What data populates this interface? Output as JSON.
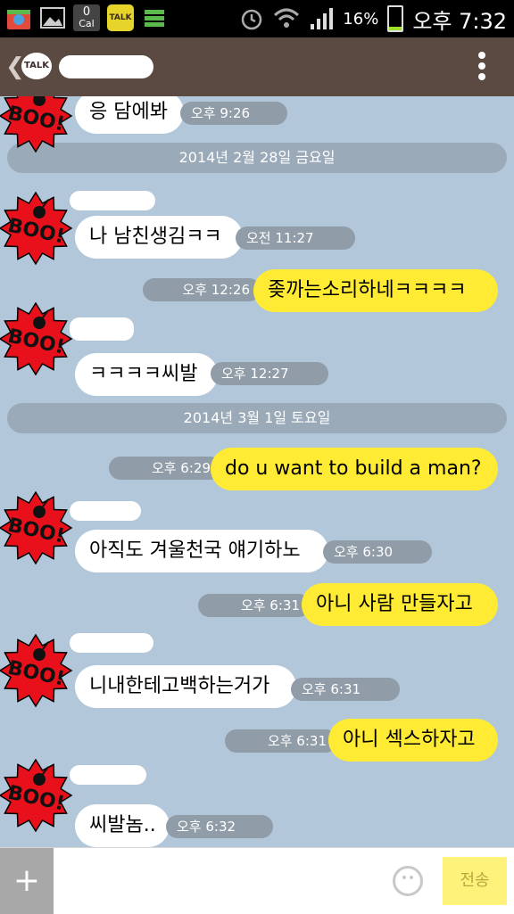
{
  "status_bar": {
    "calendar_count": "0",
    "calendar_label": "Cal",
    "kakaotalk_label": "TALK",
    "battery": "16%",
    "clock": "오후 7:32"
  },
  "header": {
    "back_glyph": "❮",
    "badge": "TALK",
    "title": "",
    "menu_icon": "overflow-menu-icon"
  },
  "chat": {
    "date_separators": [
      "2014년 2월 28일 금요일",
      "2014년 3월 1일 토요일"
    ],
    "messages": [
      {
        "side": "in",
        "text": "응 담에봐",
        "time": "오후 9:26"
      },
      {
        "side": "in",
        "text": "나 남친생김ㅋㅋ",
        "time": "오전 11:27"
      },
      {
        "side": "out",
        "text": "좆까는소리하네ㅋㅋㅋㅋ",
        "time": "오후 12:26"
      },
      {
        "side": "in",
        "text": "ㅋㅋㅋㅋ씨발",
        "time": "오후 12:27"
      },
      {
        "side": "out",
        "text": "do u want to build a man?",
        "time": "오후 6:29"
      },
      {
        "side": "in",
        "text": "아직도 겨울천국 얘기하노",
        "time": "오후 6:30"
      },
      {
        "side": "out",
        "text": "아니 사람 만들자고",
        "time": "오후 6:31"
      },
      {
        "side": "in",
        "text": "니내한테고백하는거가",
        "time": "오후 6:31"
      },
      {
        "side": "out",
        "text": "아니 섹스하자고",
        "time": "오후 6:31"
      },
      {
        "side": "in",
        "text": "씨발놈..",
        "time": "오후 6:32"
      }
    ],
    "sticker_text": "BOO!"
  },
  "input_bar": {
    "plus": "+",
    "send": "전송",
    "placeholder": ""
  },
  "colors": {
    "chat_background": "#b2c7d9",
    "header": "#5a4a42",
    "outgoing_bubble": "#ffeb33",
    "incoming_bubble": "#ffffff",
    "boo_sticker": "#e8111b"
  }
}
